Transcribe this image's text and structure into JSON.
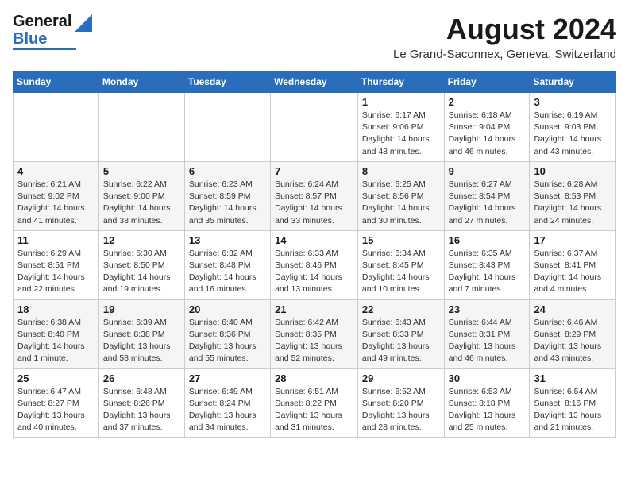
{
  "logo": {
    "line1": "General",
    "line2": "Blue"
  },
  "title": "August 2024",
  "location": "Le Grand-Saconnex, Geneva, Switzerland",
  "days_of_week": [
    "Sunday",
    "Monday",
    "Tuesday",
    "Wednesday",
    "Thursday",
    "Friday",
    "Saturday"
  ],
  "weeks": [
    [
      {
        "num": "",
        "info": ""
      },
      {
        "num": "",
        "info": ""
      },
      {
        "num": "",
        "info": ""
      },
      {
        "num": "",
        "info": ""
      },
      {
        "num": "1",
        "info": "Sunrise: 6:17 AM\nSunset: 9:06 PM\nDaylight: 14 hours and 48 minutes."
      },
      {
        "num": "2",
        "info": "Sunrise: 6:18 AM\nSunset: 9:04 PM\nDaylight: 14 hours and 46 minutes."
      },
      {
        "num": "3",
        "info": "Sunrise: 6:19 AM\nSunset: 9:03 PM\nDaylight: 14 hours and 43 minutes."
      }
    ],
    [
      {
        "num": "4",
        "info": "Sunrise: 6:21 AM\nSunset: 9:02 PM\nDaylight: 14 hours and 41 minutes."
      },
      {
        "num": "5",
        "info": "Sunrise: 6:22 AM\nSunset: 9:00 PM\nDaylight: 14 hours and 38 minutes."
      },
      {
        "num": "6",
        "info": "Sunrise: 6:23 AM\nSunset: 8:59 PM\nDaylight: 14 hours and 35 minutes."
      },
      {
        "num": "7",
        "info": "Sunrise: 6:24 AM\nSunset: 8:57 PM\nDaylight: 14 hours and 33 minutes."
      },
      {
        "num": "8",
        "info": "Sunrise: 6:25 AM\nSunset: 8:56 PM\nDaylight: 14 hours and 30 minutes."
      },
      {
        "num": "9",
        "info": "Sunrise: 6:27 AM\nSunset: 8:54 PM\nDaylight: 14 hours and 27 minutes."
      },
      {
        "num": "10",
        "info": "Sunrise: 6:28 AM\nSunset: 8:53 PM\nDaylight: 14 hours and 24 minutes."
      }
    ],
    [
      {
        "num": "11",
        "info": "Sunrise: 6:29 AM\nSunset: 8:51 PM\nDaylight: 14 hours and 22 minutes."
      },
      {
        "num": "12",
        "info": "Sunrise: 6:30 AM\nSunset: 8:50 PM\nDaylight: 14 hours and 19 minutes."
      },
      {
        "num": "13",
        "info": "Sunrise: 6:32 AM\nSunset: 8:48 PM\nDaylight: 14 hours and 16 minutes."
      },
      {
        "num": "14",
        "info": "Sunrise: 6:33 AM\nSunset: 8:46 PM\nDaylight: 14 hours and 13 minutes."
      },
      {
        "num": "15",
        "info": "Sunrise: 6:34 AM\nSunset: 8:45 PM\nDaylight: 14 hours and 10 minutes."
      },
      {
        "num": "16",
        "info": "Sunrise: 6:35 AM\nSunset: 8:43 PM\nDaylight: 14 hours and 7 minutes."
      },
      {
        "num": "17",
        "info": "Sunrise: 6:37 AM\nSunset: 8:41 PM\nDaylight: 14 hours and 4 minutes."
      }
    ],
    [
      {
        "num": "18",
        "info": "Sunrise: 6:38 AM\nSunset: 8:40 PM\nDaylight: 14 hours and 1 minute."
      },
      {
        "num": "19",
        "info": "Sunrise: 6:39 AM\nSunset: 8:38 PM\nDaylight: 13 hours and 58 minutes."
      },
      {
        "num": "20",
        "info": "Sunrise: 6:40 AM\nSunset: 8:36 PM\nDaylight: 13 hours and 55 minutes."
      },
      {
        "num": "21",
        "info": "Sunrise: 6:42 AM\nSunset: 8:35 PM\nDaylight: 13 hours and 52 minutes."
      },
      {
        "num": "22",
        "info": "Sunrise: 6:43 AM\nSunset: 8:33 PM\nDaylight: 13 hours and 49 minutes."
      },
      {
        "num": "23",
        "info": "Sunrise: 6:44 AM\nSunset: 8:31 PM\nDaylight: 13 hours and 46 minutes."
      },
      {
        "num": "24",
        "info": "Sunrise: 6:46 AM\nSunset: 8:29 PM\nDaylight: 13 hours and 43 minutes."
      }
    ],
    [
      {
        "num": "25",
        "info": "Sunrise: 6:47 AM\nSunset: 8:27 PM\nDaylight: 13 hours and 40 minutes."
      },
      {
        "num": "26",
        "info": "Sunrise: 6:48 AM\nSunset: 8:26 PM\nDaylight: 13 hours and 37 minutes."
      },
      {
        "num": "27",
        "info": "Sunrise: 6:49 AM\nSunset: 8:24 PM\nDaylight: 13 hours and 34 minutes."
      },
      {
        "num": "28",
        "info": "Sunrise: 6:51 AM\nSunset: 8:22 PM\nDaylight: 13 hours and 31 minutes."
      },
      {
        "num": "29",
        "info": "Sunrise: 6:52 AM\nSunset: 8:20 PM\nDaylight: 13 hours and 28 minutes."
      },
      {
        "num": "30",
        "info": "Sunrise: 6:53 AM\nSunset: 8:18 PM\nDaylight: 13 hours and 25 minutes."
      },
      {
        "num": "31",
        "info": "Sunrise: 6:54 AM\nSunset: 8:16 PM\nDaylight: 13 hours and 21 minutes."
      }
    ]
  ]
}
